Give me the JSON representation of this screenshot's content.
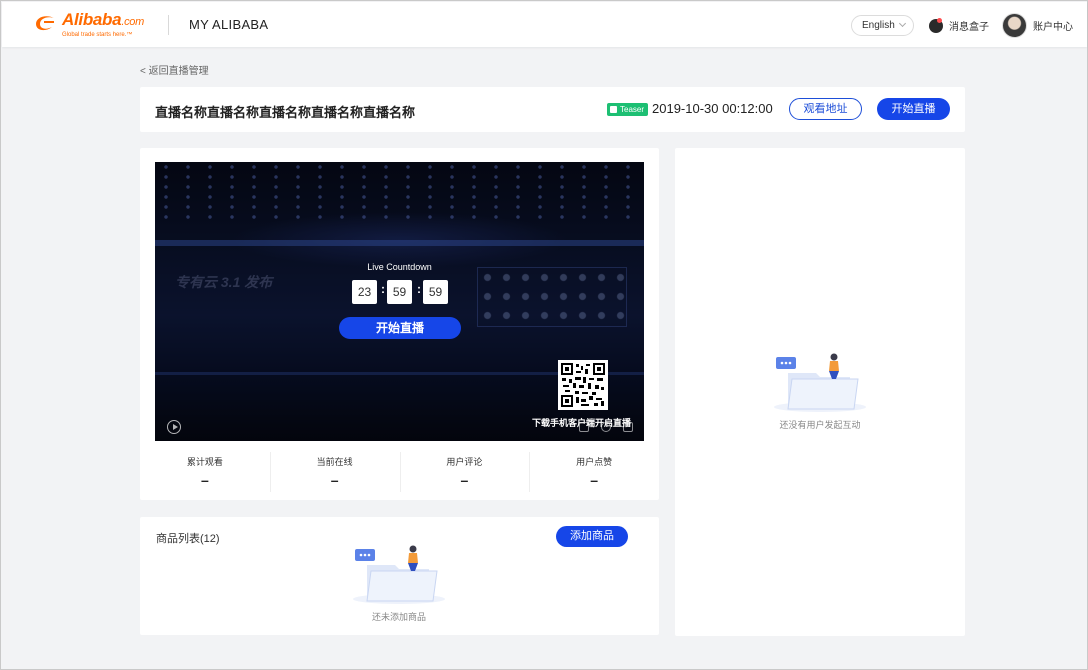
{
  "header": {
    "logo_brand": "Alibaba",
    "logo_suffix": ".com",
    "logo_tagline": "Global trade starts here.™",
    "section_title": "MY ALIBABA",
    "language": "English",
    "messages": "消息盒子",
    "account": "账户中心"
  },
  "back_link": "< 返回直播管理",
  "live": {
    "name": "直播名称直播名称直播名称直播名称直播名称",
    "badge": "Teaser",
    "datetime": "2019-10-30 00:12:00",
    "watch_url_label": "观看地址",
    "start_label": "开始直播"
  },
  "player": {
    "countdown_label": "Live Countdown",
    "hours": "23",
    "minutes": "59",
    "seconds": "59",
    "start_label": "开始直播",
    "qr_caption": "下载手机客户端开启直播",
    "bg_text": "专有云 3.1 发布"
  },
  "stats": [
    {
      "label": "累计观看",
      "value": "–"
    },
    {
      "label": "当前在线",
      "value": "–"
    },
    {
      "label": "用户评论",
      "value": "–"
    },
    {
      "label": "用户点赞",
      "value": "–"
    }
  ],
  "products": {
    "title": "商品列表(12)",
    "add_label": "添加商品",
    "empty_text": "还未添加商品"
  },
  "interaction": {
    "empty_text": "还没有用户发起互动"
  },
  "colors": {
    "primary": "#1646e8",
    "brand_orange": "#ff6a00",
    "teaser_green": "#1dbf73"
  }
}
